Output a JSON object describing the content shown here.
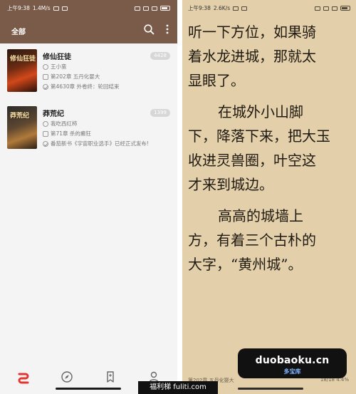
{
  "left_screen": {
    "status": {
      "time": "上午9:38",
      "speed": "1.4M/s"
    },
    "header": {
      "tab": "全部"
    },
    "books": [
      {
        "title": "修仙狂徒",
        "author": "王小蛮",
        "latest": "第202章 五丹化婴大",
        "progress": "第4630章 外卷终：轮回结束",
        "count": "4428",
        "cover_title": "修仙狂徒"
      },
      {
        "title": "莽荒纪",
        "author": "我吃西红柿",
        "latest": "第71章 杀的癫狂",
        "progress": "番茄新书《宇宙职业选手》已经正式发布!",
        "count": "1399",
        "cover_title": "莽荒纪"
      }
    ],
    "bottom_nav": {
      "icons": [
        "bookshelf-icon",
        "discover-icon",
        "bookmark-icon",
        "profile-icon"
      ]
    }
  },
  "right_screen": {
    "status": {
      "time": "上午9:38",
      "speed": "2.6K/s"
    },
    "paragraphs": [
      [
        "听一下方位，如果骑",
        "着水龙进城，那就太",
        "显眼了。"
      ],
      [
        "在城外小山脚",
        "下，降落下来，把大玉",
        "收进灵兽圈，叶空这",
        "才来到城边。"
      ],
      [
        "高高的城墙上",
        "方，有着三个古朴的",
        "大字，“黄州城”。"
      ]
    ],
    "footer": {
      "chapter": "第202章 五丹化婴大",
      "page": "18/18 4.4%"
    }
  },
  "watermark": {
    "domain": "duobaoku.cn",
    "name": "多宝库",
    "site": "福利梯 fuliti.com"
  }
}
